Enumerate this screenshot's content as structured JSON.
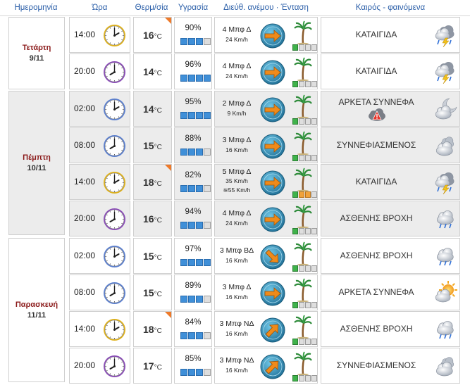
{
  "header": {
    "date": "Ημερομηνία",
    "time": "Ώρα",
    "temp": "Θερμ/σία",
    "humidity": "Υγρασία",
    "wind": "Διεύθ. ανέμου · Ένταση",
    "weather": "Καιρός - φαινόμενα"
  },
  "days": [
    {
      "name": "Τετάρτη",
      "date": "9/11"
    },
    {
      "name": "Πέμπτη",
      "date": "10/11"
    },
    {
      "name": "Παρασκευή",
      "date": "11/11"
    }
  ],
  "temp_unit": "°C",
  "rows": [
    {
      "time": "14:00",
      "clock_hour": 14,
      "temp": "16",
      "temp_max": true,
      "humidity": "90%",
      "hum_level": 3,
      "wind": "4 Μπφ Δ",
      "kmh": "24 Km/h",
      "gust": "",
      "wind_dir_deg": 0,
      "wind_level": 3,
      "weather": "ΚΑΤΑΙΓΙΔΑ",
      "icon": "thunderstorm-icon"
    },
    {
      "time": "20:00",
      "clock_hour": 20,
      "temp": "14",
      "temp_max": false,
      "humidity": "96%",
      "hum_level": 4,
      "wind": "4 Μπφ Δ",
      "kmh": "24 Km/h",
      "gust": "",
      "wind_dir_deg": 0,
      "wind_level": 3,
      "weather": "ΚΑΤΑΙΓΙΔΑ",
      "icon": "thunderstorm-icon"
    },
    {
      "time": "02:00",
      "clock_hour": 2,
      "temp": "14",
      "temp_max": false,
      "humidity": "95%",
      "hum_level": 4,
      "wind": "2 Μπφ Δ",
      "kmh": "9 Km/h",
      "gust": "",
      "wind_dir_deg": 0,
      "wind_level": 1,
      "weather": "ΑΡΚΕΤΑ ΣΥΝΝΕΦΑ",
      "icon": "night-cloud-icon",
      "warning": true
    },
    {
      "time": "08:00",
      "clock_hour": 8,
      "temp": "15",
      "temp_max": false,
      "humidity": "88%",
      "hum_level": 3,
      "wind": "3 Μπφ Δ",
      "kmh": "16 Km/h",
      "gust": "",
      "wind_dir_deg": 0,
      "wind_level": 2,
      "weather": "ΣΥΝΝΕΦΙΑΣΜΕΝΟΣ",
      "icon": "cloudy-icon"
    },
    {
      "time": "14:00",
      "clock_hour": 14,
      "temp": "18",
      "temp_max": true,
      "humidity": "82%",
      "hum_level": 3,
      "wind": "5 Μπφ Δ",
      "kmh": "35 Km/h",
      "gust": "55 Km/h",
      "wind_dir_deg": 0,
      "wind_level": 5,
      "weather": "ΚΑΤΑΙΓΙΔΑ",
      "icon": "thunderstorm-icon"
    },
    {
      "time": "20:00",
      "clock_hour": 20,
      "temp": "16",
      "temp_max": false,
      "humidity": "94%",
      "hum_level": 3,
      "wind": "4 Μπφ Δ",
      "kmh": "24 Km/h",
      "gust": "",
      "wind_dir_deg": 0,
      "wind_level": 3,
      "weather": "ΑΣΘΕΝΗΣ ΒΡΟΧΗ",
      "icon": "light-rain-icon"
    },
    {
      "time": "02:00",
      "clock_hour": 2,
      "temp": "15",
      "temp_max": false,
      "humidity": "97%",
      "hum_level": 4,
      "wind": "3 Μπφ ΒΔ",
      "kmh": "16 Km/h",
      "gust": "",
      "wind_dir_deg": 45,
      "wind_level": 2,
      "weather": "ΑΣΘΕΝΗΣ ΒΡΟΧΗ",
      "icon": "light-rain-icon"
    },
    {
      "time": "08:00",
      "clock_hour": 8,
      "temp": "15",
      "temp_max": false,
      "humidity": "89%",
      "hum_level": 3,
      "wind": "3 Μπφ Δ",
      "kmh": "16 Km/h",
      "gust": "",
      "wind_dir_deg": 0,
      "wind_level": 2,
      "weather": "ΑΡΚΕΤΑ ΣΥΝΝΕΦΑ",
      "icon": "sun-cloud-icon"
    },
    {
      "time": "14:00",
      "clock_hour": 14,
      "temp": "18",
      "temp_max": true,
      "humidity": "84%",
      "hum_level": 3,
      "wind": "3 Μπφ ΝΔ",
      "kmh": "16 Km/h",
      "gust": "",
      "wind_dir_deg": -45,
      "wind_level": 2,
      "weather": "ΑΣΘΕΝΗΣ ΒΡΟΧΗ",
      "icon": "light-rain-icon"
    },
    {
      "time": "20:00",
      "clock_hour": 20,
      "temp": "17",
      "temp_max": false,
      "humidity": "85%",
      "hum_level": 3,
      "wind": "3 Μπφ ΝΔ",
      "kmh": "16 Km/h",
      "gust": "",
      "wind_dir_deg": -45,
      "wind_level": 2,
      "weather": "ΣΥΝΝΕΦΙΑΣΜΕΝΟΣ",
      "icon": "cloudy-icon"
    }
  ],
  "colors": {
    "header_text": "#2a5ea8",
    "day_name": "#8b1a1a",
    "humidity_bar": "#3f8fd8",
    "wind_bar": "#3fb24a",
    "compass": "#2f8fb4",
    "arrow": "#ef8a1a",
    "max_temp_flag": "#ee7a2a"
  }
}
